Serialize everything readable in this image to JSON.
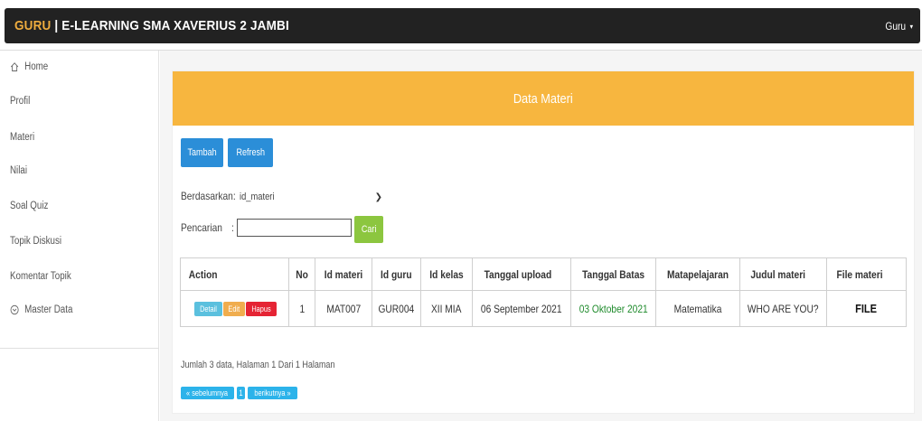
{
  "navbar": {
    "brand_accent": "GURU",
    "brand_rest": " | E-LEARNING SMA XAVERIUS 2 JAMBI",
    "user_label": "Guru",
    "user_caret": "▾"
  },
  "sidebar": {
    "items": [
      {
        "label": "Home",
        "icon": "home-icon"
      },
      {
        "label": "Profil"
      },
      {
        "label": "Materi"
      },
      {
        "label": "Nilai"
      },
      {
        "label": "Soal Quiz"
      },
      {
        "label": "Topik Diskusi"
      },
      {
        "label": "Komentar Topik"
      },
      {
        "label": "Master Data",
        "icon": "chevron-circle-down-icon"
      }
    ]
  },
  "panel": {
    "title": "Data Materi"
  },
  "toolbar": {
    "add_label": "Tambah",
    "refresh_label": "Refresh"
  },
  "filter": {
    "based_on_label": "Berdasarkan:",
    "based_on_value": "id_materi",
    "search_label": "Pencarian",
    "search_colon": ":",
    "search_value": "",
    "search_button": "Cari"
  },
  "table": {
    "headers": [
      "Action",
      "No",
      "Id materi",
      "Id guru",
      "Id kelas",
      "Tanggal upload",
      "Tanggal Batas",
      "Matapelajaran",
      "Judul materi",
      "File materi"
    ],
    "rows": [
      {
        "actions": {
          "detail": "Detail",
          "edit": "Edit",
          "delete": "Hapus"
        },
        "no": "1",
        "id_materi": "MAT007",
        "id_guru": "GUR004",
        "id_kelas": "XII MIA",
        "tanggal_upload": "06 September 2021",
        "tanggal_batas": "03 Oktober 2021",
        "matapelajaran": "Matematika",
        "judul_materi": "WHO ARE YOU?",
        "file_materi": "FILE"
      }
    ]
  },
  "summary": "Jumlah 3 data, Halaman 1 Dari 1 Halaman",
  "pagination": {
    "prev": "« sebelumnya",
    "current": "1",
    "next": "berikutnya »"
  },
  "colors": {
    "navbar": "#222222",
    "brand_accent": "#f0ad3e",
    "panel_heading": "#f7b63f",
    "primary": "#2b8ed8",
    "success": "#8cc63f",
    "info": "#5bc0de",
    "warning": "#f0ad4e",
    "danger": "#e52434",
    "date_green": "#1f8b2c"
  }
}
